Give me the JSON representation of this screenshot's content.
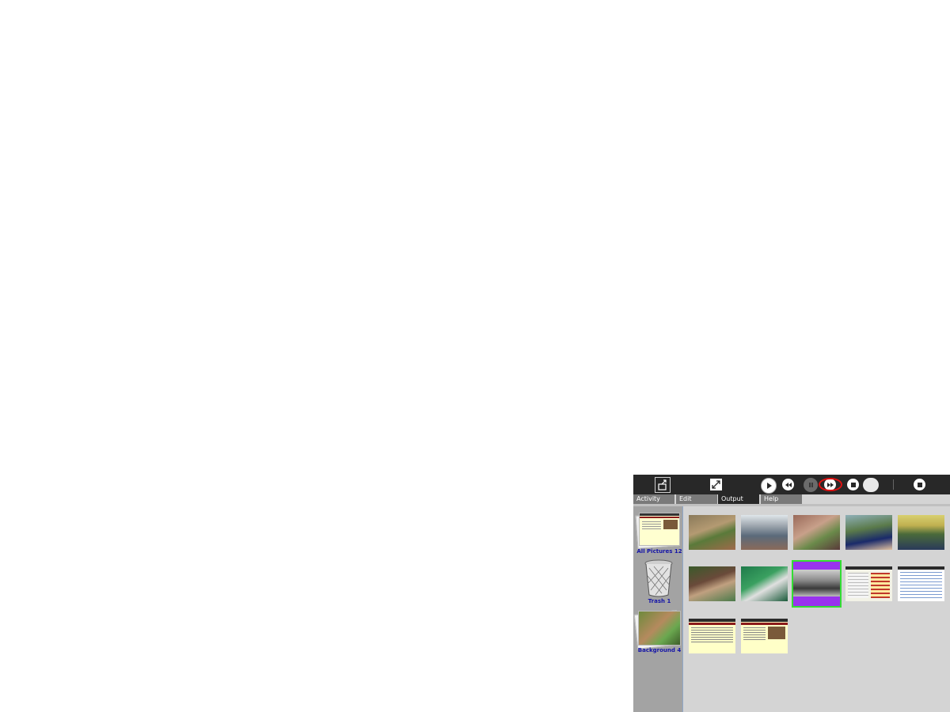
{
  "toolbar": {
    "share_icon": "share-activity-icon",
    "fullscreen_icon": "fullscreen-icon",
    "play_icon": "play-icon",
    "rewind_icon": "rewind-icon",
    "pause_icon": "pause-icon",
    "forward_icon": "fast-forward-icon",
    "stop_icon": "stop-icon",
    "toggle_icon": "toggle-icon",
    "close_icon": "stop-activity-icon",
    "highlight_color": "#e01010"
  },
  "tabs": [
    {
      "label": "Activity",
      "active": false
    },
    {
      "label": "Edit",
      "active": false
    },
    {
      "label": "Output",
      "active": true
    },
    {
      "label": "Help",
      "active": false
    }
  ],
  "collections": [
    {
      "label": "All Pictures 12"
    },
    {
      "label": "Trash 1"
    },
    {
      "label": "Background 4"
    }
  ],
  "thumbnails": [
    {
      "kind": "photo",
      "selected": false
    },
    {
      "kind": "photo",
      "selected": false
    },
    {
      "kind": "photo",
      "selected": false
    },
    {
      "kind": "photo",
      "selected": false
    },
    {
      "kind": "photo",
      "selected": false
    },
    {
      "kind": "photo",
      "selected": false
    },
    {
      "kind": "photo",
      "selected": false
    },
    {
      "kind": "photo",
      "selected": true
    },
    {
      "kind": "screenshot",
      "selected": false
    },
    {
      "kind": "screenshot",
      "selected": false
    },
    {
      "kind": "document",
      "selected": false
    },
    {
      "kind": "document",
      "selected": false
    }
  ],
  "colors": {
    "toolbar_bg": "#282828",
    "sidebar_bg": "#a3a3a3",
    "collection_label": "#1515a8",
    "selection_outline": "#33dd33",
    "selected_background": "#9933ee"
  }
}
